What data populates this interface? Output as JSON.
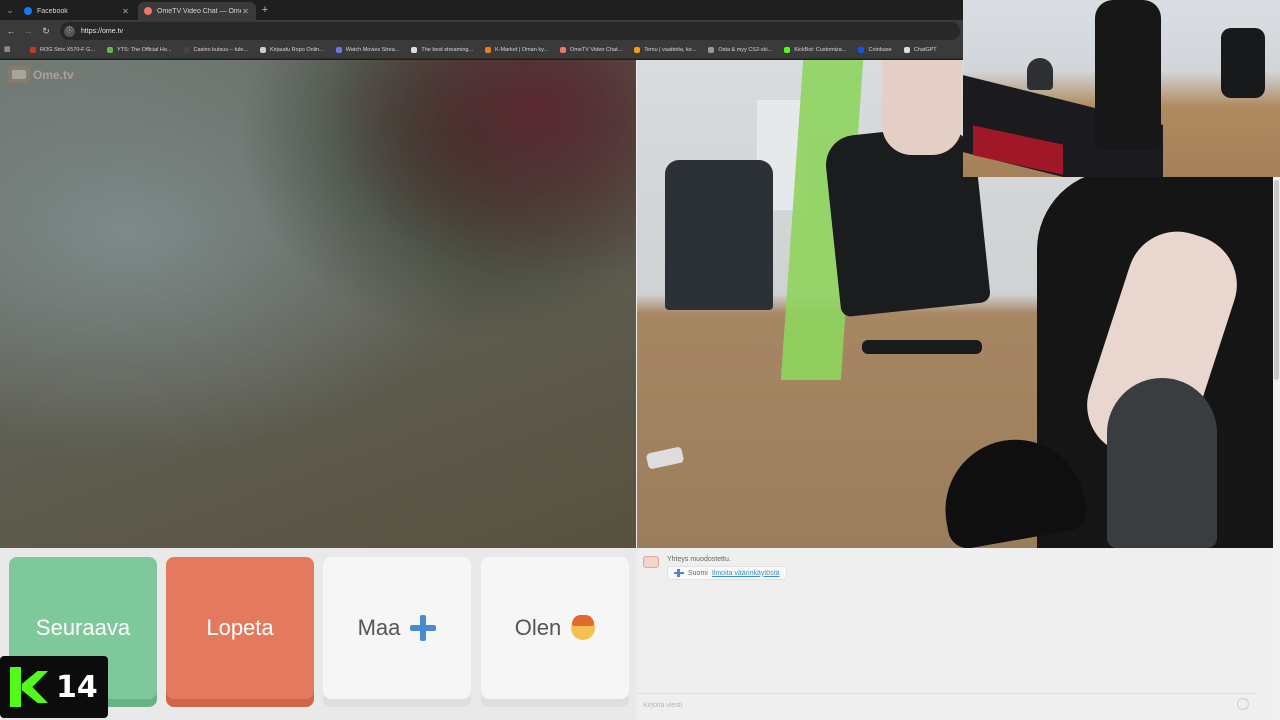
{
  "browser": {
    "tabs": [
      {
        "label": "Facebook",
        "color": "#1877f2"
      },
      {
        "label": "OmeTV Video Chat — Ome",
        "color": "#e8786a"
      }
    ],
    "url": "https://ome.tv",
    "bookmarks": [
      {
        "label": "ROG Strix X570-F G...",
        "color": "#c0392b"
      },
      {
        "label": "YTS: The Official Ho...",
        "color": "#6ab04c"
      },
      {
        "label": "Casino kutsuu – tule...",
        "color": "#444444"
      },
      {
        "label": "Kirjaudu Ropo Onlin...",
        "color": "#cccccc"
      },
      {
        "label": "Watch Movies Strea...",
        "color": "#6c7ae0"
      },
      {
        "label": "The best streaming...",
        "color": "#dddddd"
      },
      {
        "label": "K-Market | Oman ky...",
        "color": "#e67e22"
      },
      {
        "label": "OmeTV Video Chat...",
        "color": "#e8786a"
      },
      {
        "label": "Temu | vaatteita, ke...",
        "color": "#f39c12"
      },
      {
        "label": "Osta & myy CS2-ski...",
        "color": "#999999"
      },
      {
        "label": "KickBot: Customiza...",
        "color": "#53fc18"
      },
      {
        "label": "Coinbase",
        "color": "#1652f0"
      },
      {
        "label": "ChatGPT",
        "color": "#dddddd"
      }
    ]
  },
  "site": {
    "logo_text": "Ome.tv"
  },
  "controls": {
    "next": "Seuraava",
    "stop": "Lopeta",
    "country": "Maa",
    "gender": "Olen"
  },
  "chat": {
    "status": "Yhteys muodostettu.",
    "language": "Suomi",
    "report_link": "Ilmoita väärinkäytöstä",
    "input_placeholder": "Kirjoita viesti"
  },
  "badge": {
    "number": "14",
    "accent": "#53fc18"
  }
}
